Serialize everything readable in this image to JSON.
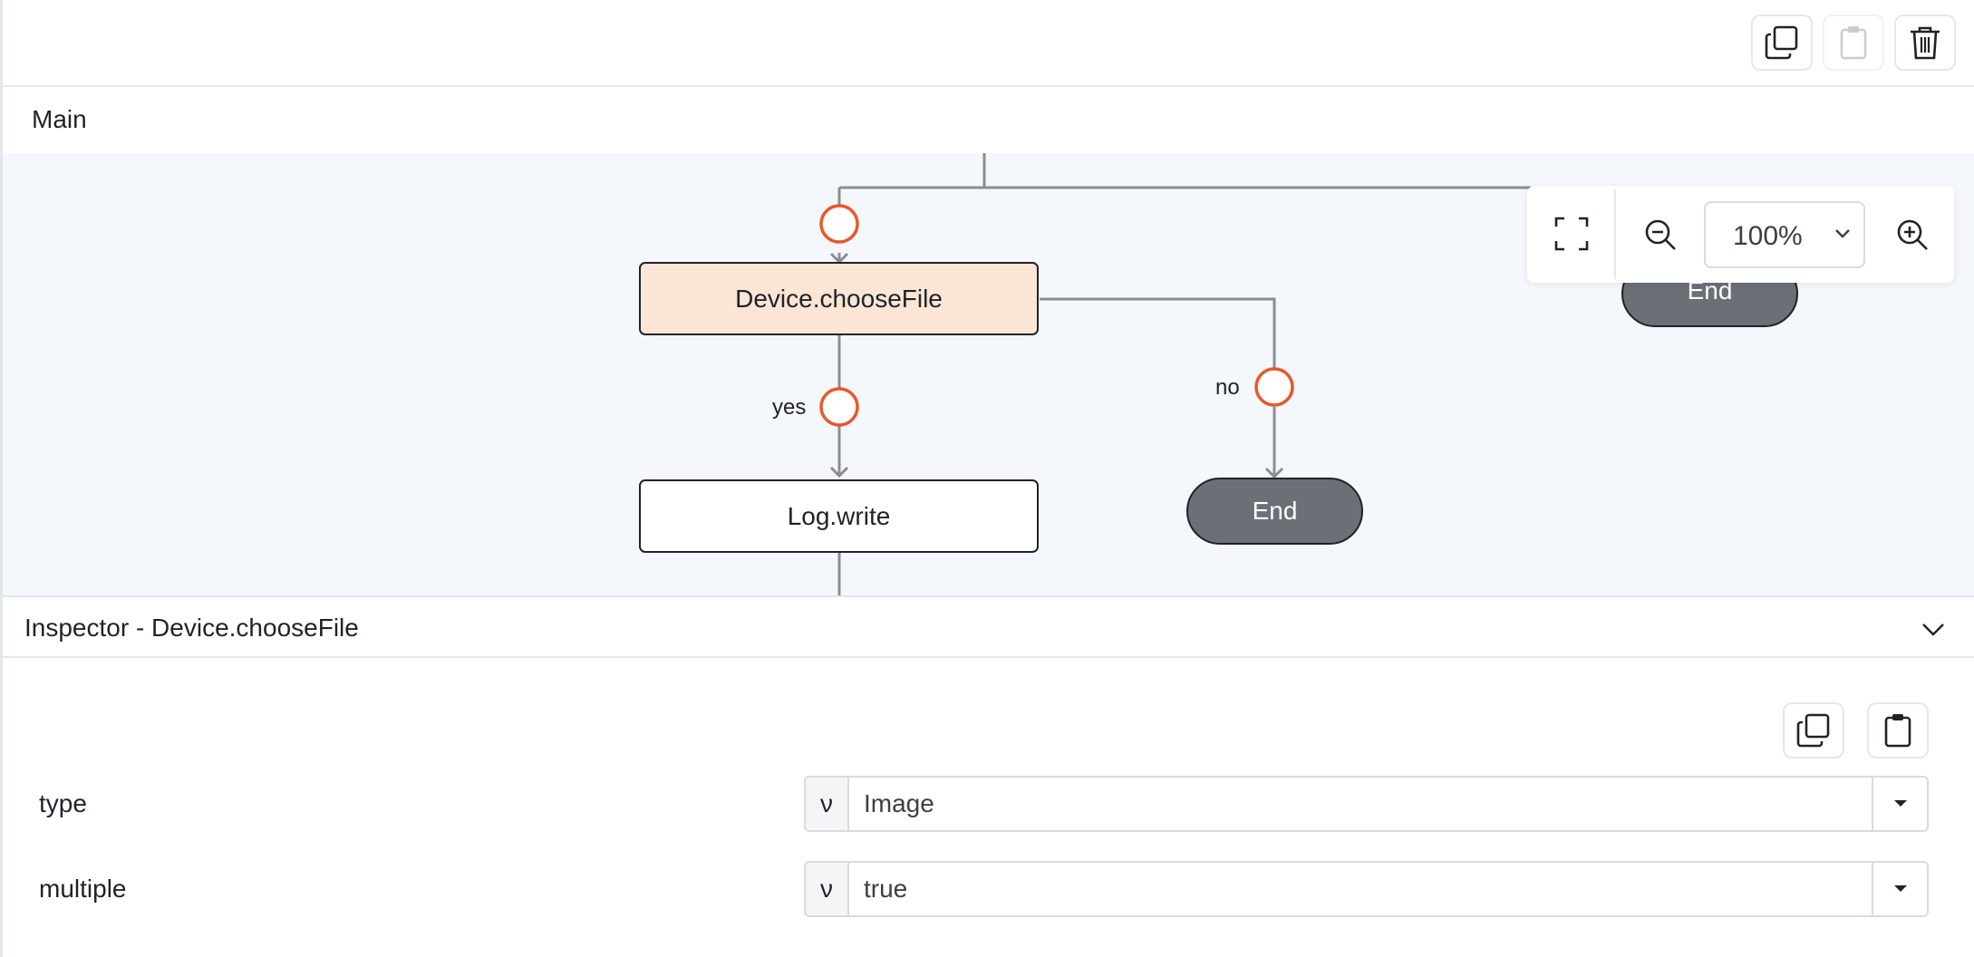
{
  "toolbar": {
    "copy_icon": "copy-icon",
    "paste_icon": "clipboard-icon",
    "delete_icon": "trash-icon"
  },
  "section": {
    "title": "Main"
  },
  "flow": {
    "nodes": {
      "choose_file": "Device.chooseFile",
      "log_write": "Log.write",
      "end_no": "End",
      "end_right": "End"
    },
    "edge_labels": {
      "yes": "yes",
      "no": "no"
    },
    "colors": {
      "connector": "#e8582a",
      "edge": "#8a8d91",
      "active_node": "#fbe5d4",
      "end_node": "#6b7076"
    }
  },
  "zoom": {
    "value": "100%",
    "options_visible": [
      "100%"
    ]
  },
  "inspector": {
    "title": "Inspector - Device.chooseFile",
    "properties": [
      {
        "label": "type",
        "mode": "ν",
        "value": "Image"
      },
      {
        "label": "multiple",
        "mode": "ν",
        "value": "true"
      }
    ]
  }
}
